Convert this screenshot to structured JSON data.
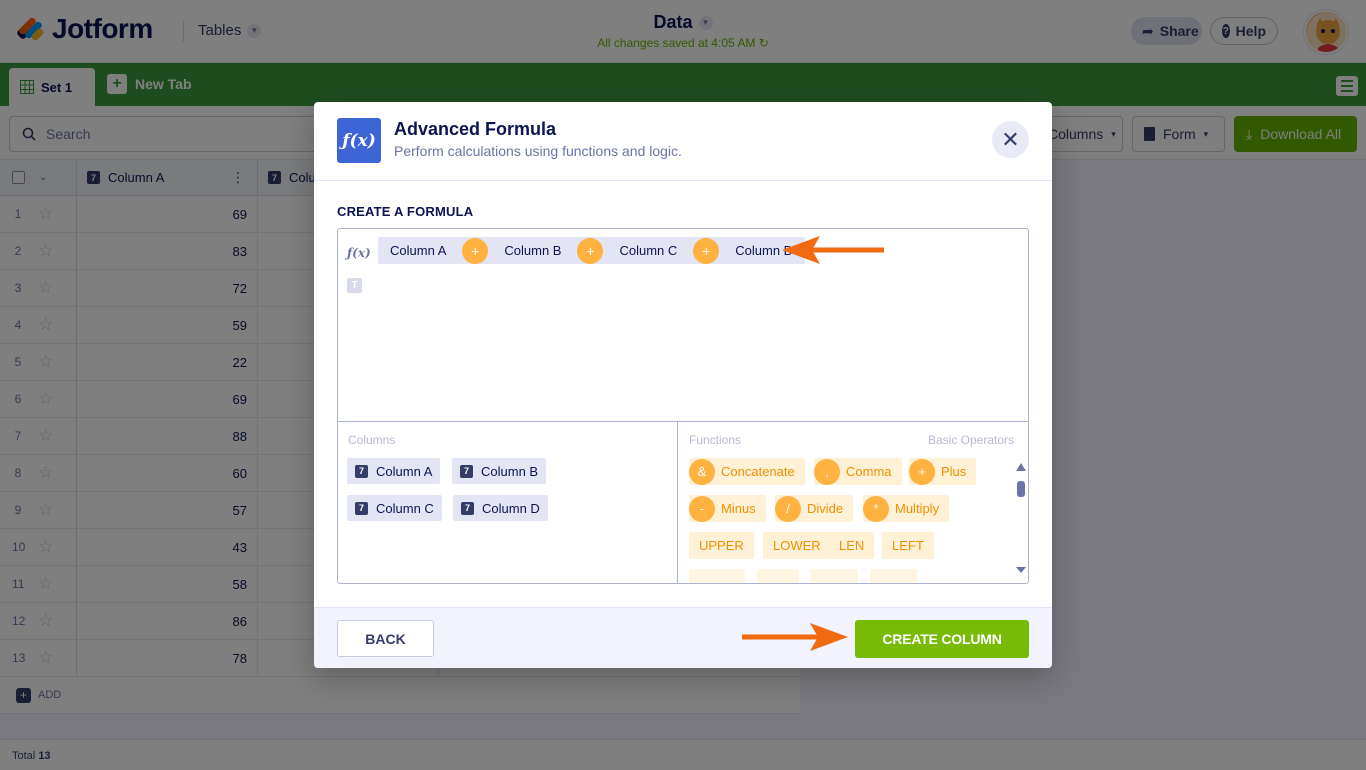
{
  "header": {
    "logo_text": "Jotform",
    "tables_label": "Tables",
    "doc_title": "Data",
    "saved_status": "All changes saved at 4:05 AM",
    "share_label": "Share",
    "help_label": "Help"
  },
  "tabs": {
    "set_label": "Set 1",
    "new_tab_label": "New Tab"
  },
  "toolbar": {
    "search_placeholder": "Search",
    "columns_label": "Columns",
    "form_label": "Form",
    "download_label": "Download All"
  },
  "grid": {
    "columns": [
      "Column A",
      "Colu"
    ],
    "rows": [
      {
        "num": "1",
        "value": "69"
      },
      {
        "num": "2",
        "value": "83"
      },
      {
        "num": "3",
        "value": "72"
      },
      {
        "num": "4",
        "value": "59"
      },
      {
        "num": "5",
        "value": "22"
      },
      {
        "num": "6",
        "value": "69"
      },
      {
        "num": "7",
        "value": "88"
      },
      {
        "num": "8",
        "value": "60"
      },
      {
        "num": "9",
        "value": "57"
      },
      {
        "num": "10",
        "value": "43"
      },
      {
        "num": "11",
        "value": "58"
      },
      {
        "num": "12",
        "value": "86"
      },
      {
        "num": "13",
        "value": "78"
      }
    ],
    "add_label": "ADD",
    "total_label": "Total",
    "total_count": "13"
  },
  "modal": {
    "title": "Advanced Formula",
    "subtitle": "Perform calculations using functions and logic.",
    "section_label": "CREATE A FORMULA",
    "formula_tokens": [
      "Column A",
      "+",
      "Column B",
      "+",
      "Column C",
      "+",
      "Column D"
    ],
    "columns_pane_label": "Columns",
    "column_chips": [
      "Column A",
      "Column B",
      "Column C",
      "Column D"
    ],
    "functions_pane_label": "Functions",
    "operators_pane_label": "Basic Operators",
    "operators": [
      {
        "symbol": "&",
        "label": "Concatenate"
      },
      {
        "symbol": ",",
        "label": "Comma"
      },
      {
        "symbol": "+",
        "label": "Plus"
      },
      {
        "symbol": "-",
        "label": "Minus"
      },
      {
        "symbol": "/",
        "label": "Divide"
      },
      {
        "symbol": "*",
        "label": "Multiply"
      }
    ],
    "functions": [
      "UPPER",
      "LOWER",
      "LEN",
      "LEFT"
    ],
    "back_label": "BACK",
    "create_label": "CREATE COLUMN"
  },
  "colors": {
    "brand_green": "#3a9b3f",
    "accent_green": "#78bb07",
    "accent_orange": "#ffb23f",
    "annotation_orange": "#f26a10",
    "modal_blue": "#3d65d6"
  }
}
